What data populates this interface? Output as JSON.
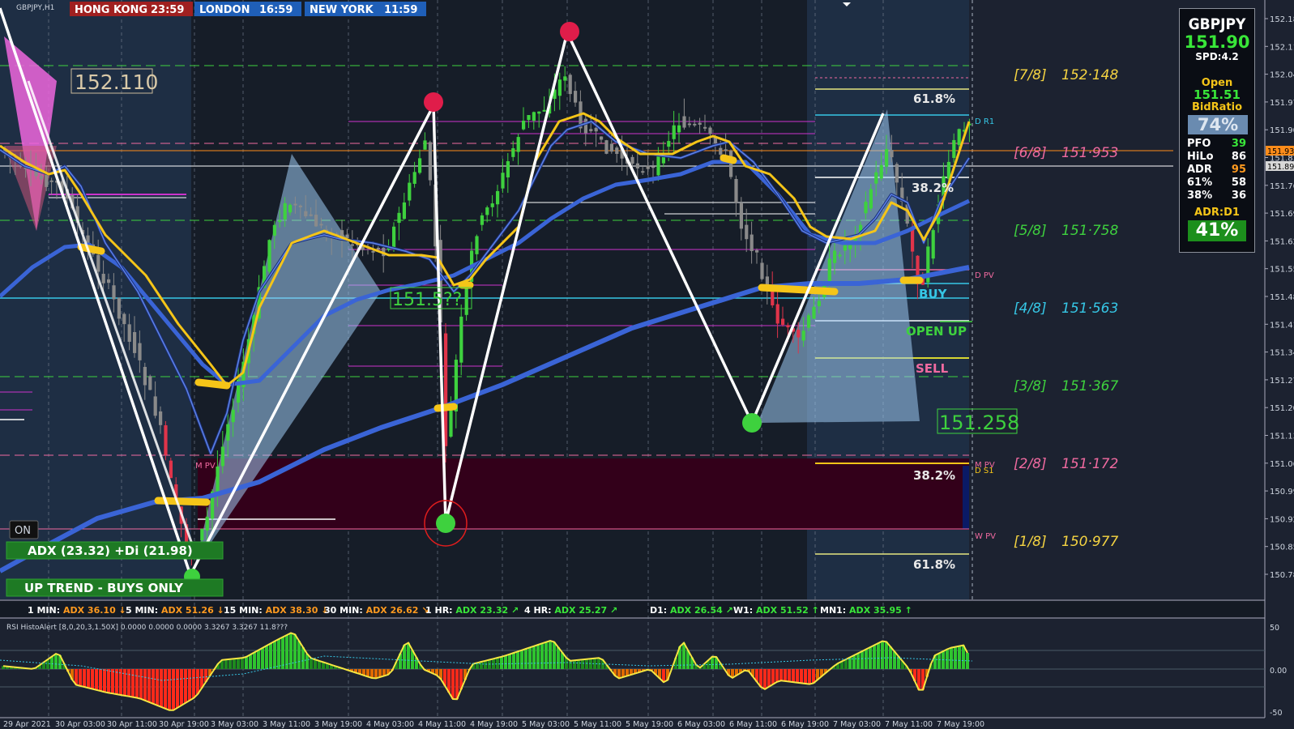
{
  "symbol_label": "GBPJPY,H1",
  "sessions": [
    {
      "label": "HONG KONG",
      "time": "23:59",
      "color": "#a02020"
    },
    {
      "label": "LONDON",
      "time": "16:59",
      "color": "#1f5fb8"
    },
    {
      "label": "NEW YORK",
      "time": "11:59",
      "color": "#1f5fb8"
    }
  ],
  "annotations": {
    "high_label": "152.110",
    "mid_label": "151.5??",
    "low_label": "151.258",
    "fib_top": "61.8%",
    "fib_mid": "38.2%",
    "fib_low": "38.2%",
    "fib_bottom": "61.8%",
    "buy": "BUY",
    "open_up": "OPEN UP",
    "sell": "SELL",
    "on_button": "ON",
    "adx_box": "ADX (23.32)   +Di (21.98)",
    "trend_box": "UP TREND - BUYS ONLY",
    "mpv_left": "M PV",
    "mpv_right": "M PV",
    "ds1": "D S1",
    "dr1": "D R1",
    "dpv": "D PV",
    "wpv": "W PV"
  },
  "murrey": [
    {
      "label": "[7/8]",
      "value": "152·148",
      "color": "#f5d442"
    },
    {
      "label": "[6/8]",
      "value": "151·953",
      "color": "#f06aa0"
    },
    {
      "label": "[5/8]",
      "value": "151·758",
      "color": "#3ed13e"
    },
    {
      "label": "[4/8]",
      "value": "151·563",
      "color": "#36c7e6"
    },
    {
      "label": "[3/8]",
      "value": "151·367",
      "color": "#3ed13e"
    },
    {
      "label": "[2/8]",
      "value": "151·172",
      "color": "#f06aa0"
    },
    {
      "label": "[1/8]",
      "value": "150·977",
      "color": "#f5d442"
    }
  ],
  "panel": {
    "symbol": "GBPJPY",
    "price": "151.90",
    "spread": "SPD:4.2",
    "open_label": "Open",
    "open_value": "151.51",
    "bidratio_label": "BidRatio",
    "bidratio_value": "74%",
    "rows": [
      {
        "k": "PFO",
        "v": "39",
        "color": "#39e639"
      },
      {
        "k": "HiLo",
        "v": "86",
        "color": "#ffffff"
      },
      {
        "k": "ADR",
        "v": "95",
        "color": "#ff9a1f"
      },
      {
        "k": "61%",
        "v": "58",
        "color": "#ffffff"
      },
      {
        "k": "38%",
        "v": "36",
        "color": "#ffffff"
      }
    ],
    "adr_label": "ADR:D1",
    "adr_value": "41%"
  },
  "price_axis": [
    "152.185",
    "152.115",
    "152.045",
    "151.975",
    "151.905",
    "151.835",
    "151.765",
    "151.695",
    "151.625",
    "151.555",
    "151.485",
    "151.415",
    "151.345",
    "151.275",
    "151.205",
    "151.135",
    "151.065",
    "150.995",
    "150.925",
    "150.855",
    "150.785"
  ],
  "price_tags": [
    {
      "value": "151.937",
      "bg": "#ff8c1a",
      "fg": "#000"
    },
    {
      "value": "151.895",
      "bg": "#d8d8d8",
      "fg": "#000"
    }
  ],
  "adx_bar": [
    {
      "tf": "1 MIN:",
      "adx": "ADX 36.10",
      "arrow": "↓",
      "color": "#ff9a1f"
    },
    {
      "tf": "5 MIN:",
      "adx": "ADX 51.26",
      "arrow": "↓",
      "color": "#ff9a1f"
    },
    {
      "tf": "15 MIN:",
      "adx": "ADX 38.30",
      "arrow": "↓",
      "color": "#ff9a1f"
    },
    {
      "tf": "30 MIN:",
      "adx": "ADX 26.62",
      "arrow": "↘",
      "color": "#ff9a1f"
    },
    {
      "tf": "1 HR:",
      "adx": "ADX 23.32",
      "arrow": "↗",
      "color": "#39e639"
    },
    {
      "tf": "4 HR:",
      "adx": "ADX 25.27",
      "arrow": "↗",
      "color": "#39e639"
    },
    {
      "tf": "D1:",
      "adx": "ADX 26.54",
      "arrow": "↗",
      "color": "#39e639"
    },
    {
      "tf": "W1:",
      "adx": "ADX 51.52",
      "arrow": "↑",
      "color": "#39e639"
    },
    {
      "tf": "MN1:",
      "adx": "ADX 35.95",
      "arrow": "↑",
      "color": "#39e639"
    }
  ],
  "rsi_label": "RSI HistoAlert [8,0,20,3,1.50X] 0.0000 0.0000 0.0000 3.3267 3.3267 11.8???",
  "rsi_axis": [
    "50",
    "0.00",
    "-50"
  ],
  "time_axis": [
    "29 Apr 2021",
    "30 Apr 03:00",
    "30 Apr 11:00",
    "30 Apr 19:00",
    "3 May 03:00",
    "3 May 11:00",
    "3 May 19:00",
    "4 May 03:00",
    "4 May 11:00",
    "4 May 19:00",
    "5 May 03:00",
    "5 May 11:00",
    "5 May 19:00",
    "6 May 03:00",
    "6 May 11:00",
    "6 May 19:00",
    "7 May 03:00",
    "7 May 11:00",
    "7 May 19:00"
  ],
  "colors": {
    "background": "#1c2230",
    "bull_candle": "#3ed13e",
    "bear_candle": "#8a8a8a",
    "ma_blue": "#3a64d6",
    "ma_yellow": "#f5c518",
    "zigzag": "#ffffff",
    "zone": "#3a0010"
  }
}
